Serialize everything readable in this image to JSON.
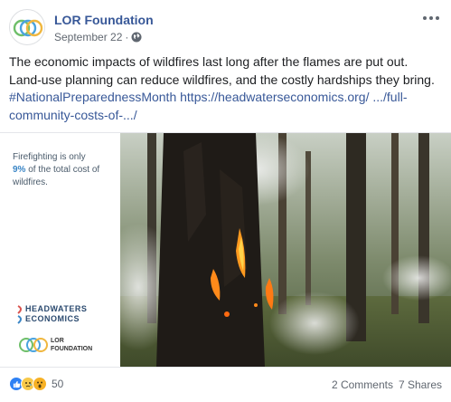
{
  "page": {
    "name": "LOR Foundation",
    "date": "September 22",
    "separator": "·"
  },
  "post": {
    "text": "The economic impacts of wildfires last long after the flames are put out. Land-use planning can reduce wildfires, and the costly hardships they bring.",
    "hashtag": "#NationalPreparednessMonth",
    "link_line1": "https://headwaterseconomics.org/",
    "link_line2": ".../full-community-costs-of-.../"
  },
  "image": {
    "caption_pre": "Firefighting is only",
    "caption_pct": "9%",
    "caption_post": "of the total cost of wildfires.",
    "logo_headwaters_line1": "HEADWATERS",
    "logo_headwaters_line2": "ECONOMICS",
    "logo_lor_line1": "LOR",
    "logo_lor_line2": "FOUNDATION"
  },
  "footer": {
    "reaction_count": "50",
    "comments": "2 Comments",
    "shares": "7 Shares"
  },
  "colors": {
    "link": "#385898",
    "like": "#2e81f4",
    "sad": "#f7c94a",
    "wow": "#f7b125"
  },
  "icons": [
    "globe-icon",
    "more-options-icon",
    "like-reaction-icon",
    "sad-reaction-icon",
    "wow-reaction-icon",
    "lor-rings-icon"
  ]
}
